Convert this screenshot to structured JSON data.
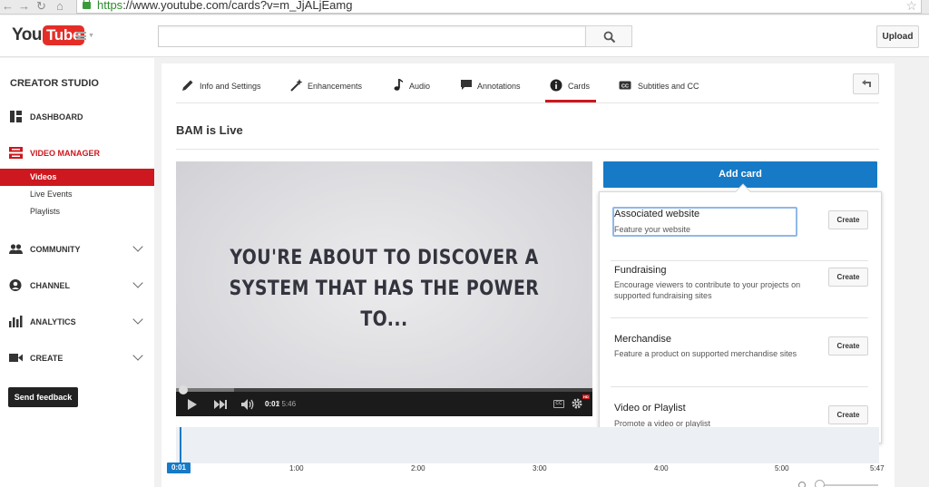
{
  "browser": {
    "url_scheme": "https",
    "url_rest": "://www.youtube.com/cards?v=m_JjALjEamg"
  },
  "header": {
    "logo_you": "You",
    "logo_tube": "Tube",
    "search_placeholder": "",
    "upload_label": "Upload"
  },
  "sidebar": {
    "title": "CREATOR STUDIO",
    "items": [
      {
        "label": "DASHBOARD",
        "icon": "dashboard-icon"
      },
      {
        "label": "VIDEO MANAGER",
        "icon": "video-manager-icon"
      },
      {
        "label": "COMMUNITY",
        "icon": "community-icon"
      },
      {
        "label": "CHANNEL",
        "icon": "channel-icon"
      },
      {
        "label": "ANALYTICS",
        "icon": "analytics-icon"
      },
      {
        "label": "CREATE",
        "icon": "create-icon"
      }
    ],
    "sub_items": [
      "Videos",
      "Live Events",
      "Playlists"
    ],
    "feedback_label": "Send feedback"
  },
  "tabs": [
    {
      "label": "Info and Settings",
      "icon": "pencil-icon"
    },
    {
      "label": "Enhancements",
      "icon": "magic-wand-icon"
    },
    {
      "label": "Audio",
      "icon": "music-note-icon"
    },
    {
      "label": "Annotations",
      "icon": "speech-bubble-icon"
    },
    {
      "label": "Cards",
      "icon": "info-icon"
    },
    {
      "label": "Subtitles and CC",
      "icon": "cc-icon"
    }
  ],
  "video": {
    "title": "BAM is Live",
    "overlay_line1": "YOU'RE ABOUT TO DISCOVER A",
    "overlay_line2": "SYSTEM THAT HAS THE POWER TO...",
    "current_time": "0:01",
    "duration": "/ 5:46",
    "cc_label": "CC",
    "hd_label": "HD",
    "buffered_fraction": 0.14
  },
  "cards": {
    "add_label": "Add card",
    "create_label": "Create",
    "types": [
      {
        "title": "Associated website",
        "desc": "Feature your website"
      },
      {
        "title": "Fundraising",
        "desc": "Encourage viewers to contribute to your projects on supported fundraising sites"
      },
      {
        "title": "Merchandise",
        "desc": "Feature a product on supported merchandise sites"
      },
      {
        "title": "Video or Playlist",
        "desc": "Promote a video or playlist"
      }
    ]
  },
  "timeline": {
    "current": "0:01",
    "ticks": [
      "1:00",
      "2:00",
      "3:00",
      "4:00",
      "5:00",
      "5:47"
    ]
  },
  "colors": {
    "brand_red": "#cc181e",
    "accent_blue": "#167ac6"
  }
}
